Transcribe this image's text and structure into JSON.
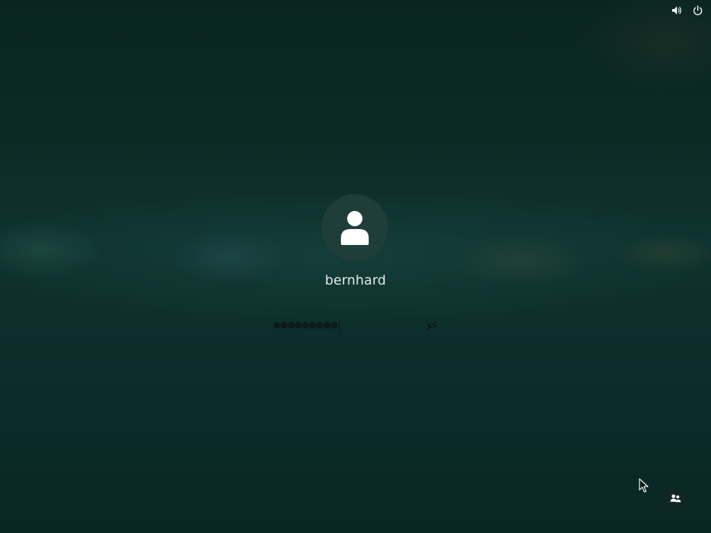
{
  "top_bar": {
    "icons": [
      "volume-icon",
      "power-icon"
    ]
  },
  "login": {
    "username": "bernhard",
    "password_mask": "●●●●●●●●●",
    "icons": {
      "avatar": "user-icon",
      "reveal": "eye-crossed-icon",
      "switch_user": "users-icon"
    }
  },
  "colors": {
    "text": "#e6ebea",
    "avatar_bg": "#1f3e3a",
    "background": "#0c2a24"
  }
}
